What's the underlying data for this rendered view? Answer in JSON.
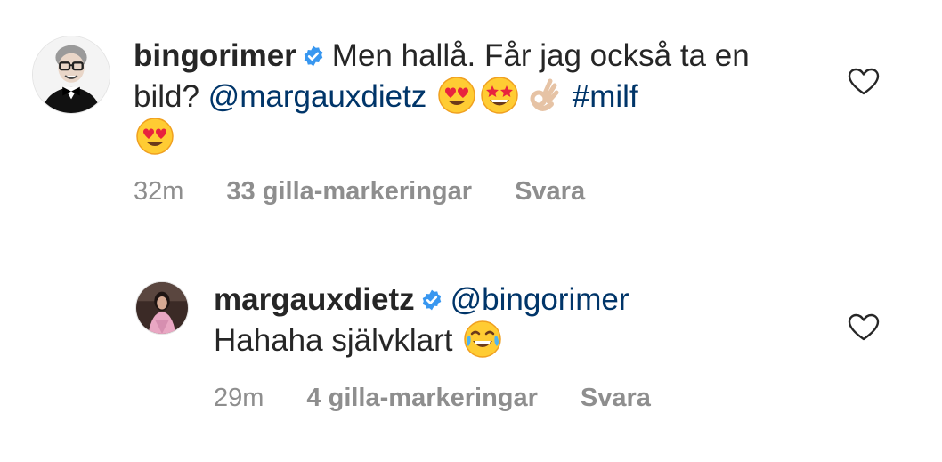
{
  "comments": [
    {
      "username": "bingorimer",
      "verified": true,
      "text_before": "Men hallå. Får jag också ta en bild? ",
      "mention": "@margauxdietz",
      "emojis_inline": [
        "heart-eyes-emoji",
        "star-struck-emoji",
        "ok-hand-emoji"
      ],
      "hashtag": "#milf",
      "trailing_emoji": "heart-eyes-emoji",
      "time": "32m",
      "likes": "33 gilla-markeringar",
      "reply": "Svara"
    },
    {
      "username": "margauxdietz",
      "verified": true,
      "mention": "@bingorimer",
      "text": "Hahaha självklart",
      "emoji": "tears-of-joy-emoji",
      "time": "29m",
      "likes": "4 gilla-markeringar",
      "reply": "Svara"
    }
  ],
  "colors": {
    "text": "#262626",
    "link": "#003569",
    "meta": "#8e8e8e",
    "verified": "#3897f0"
  }
}
